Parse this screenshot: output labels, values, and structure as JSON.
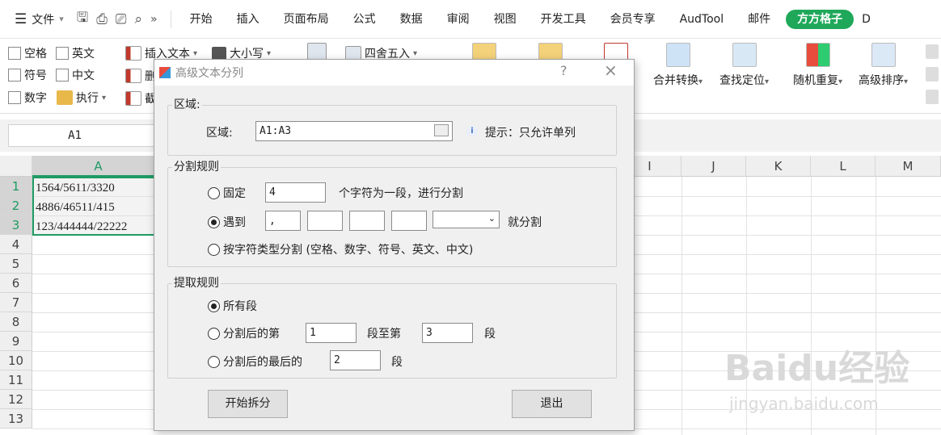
{
  "menubar": {
    "file_label": "文件",
    "tabs": [
      "开始",
      "插入",
      "页面布局",
      "公式",
      "数据",
      "审阅",
      "视图",
      "开发工具",
      "会员专享",
      "AudTool",
      "邮件",
      "方方格子",
      "D"
    ],
    "active_tab": "方方格子"
  },
  "ribbon": {
    "checkboxes": [
      "空格",
      "英文",
      "符号",
      "中文",
      "数字"
    ],
    "execute_label": "执行",
    "insert_text_label": "插入文本",
    "case_label": "大小写",
    "round_label": "四舍五入",
    "delete_label": "删",
    "cut_label": "截",
    "merge_convert_label": "合并转换",
    "find_locate_label": "查找定位",
    "random_repeat_label": "随机重复",
    "advanced_sort_label": "高级排序"
  },
  "formula_bar": {
    "name_box": "A1"
  },
  "sheet": {
    "columns_left": [
      "A"
    ],
    "columns_right": [
      "I",
      "J",
      "K",
      "L",
      "M"
    ],
    "rows": [
      "1",
      "2",
      "3",
      "4",
      "5",
      "6",
      "7",
      "8",
      "9",
      "10",
      "11",
      "12",
      "13"
    ],
    "cells": [
      "1564/5611/3320",
      "4886/46511/415",
      "123/444444/22222"
    ]
  },
  "dialog": {
    "title": "高级文本分列",
    "help": "?",
    "close": "×",
    "area_group": "区域:",
    "area_label": "区域:",
    "area_value": "A1:A3",
    "hint": "提示：只允许单列",
    "split_group": "分割规则",
    "fixed_label": "固定",
    "fixed_value": "4",
    "fixed_suffix": "个字符为一段，进行分割",
    "meet_label": "遇到",
    "meet_value1": ",",
    "meet_suffix": "就分割",
    "chartype_label": "按字符类型分割 (空格、数字、符号、英文、中文)",
    "extract_group": "提取规则",
    "all_label": "所有段",
    "after_split_label": "分割后的第",
    "from_value": "1",
    "to_label": "段至第",
    "to_value": "3",
    "seg_label": "段",
    "last_label": "分割后的最后的",
    "last_value": "2",
    "start_button": "开始拆分",
    "exit_button": "退出"
  },
  "watermark": {
    "line1": "Baidu经验",
    "line2": "jingyan.baidu.com"
  }
}
